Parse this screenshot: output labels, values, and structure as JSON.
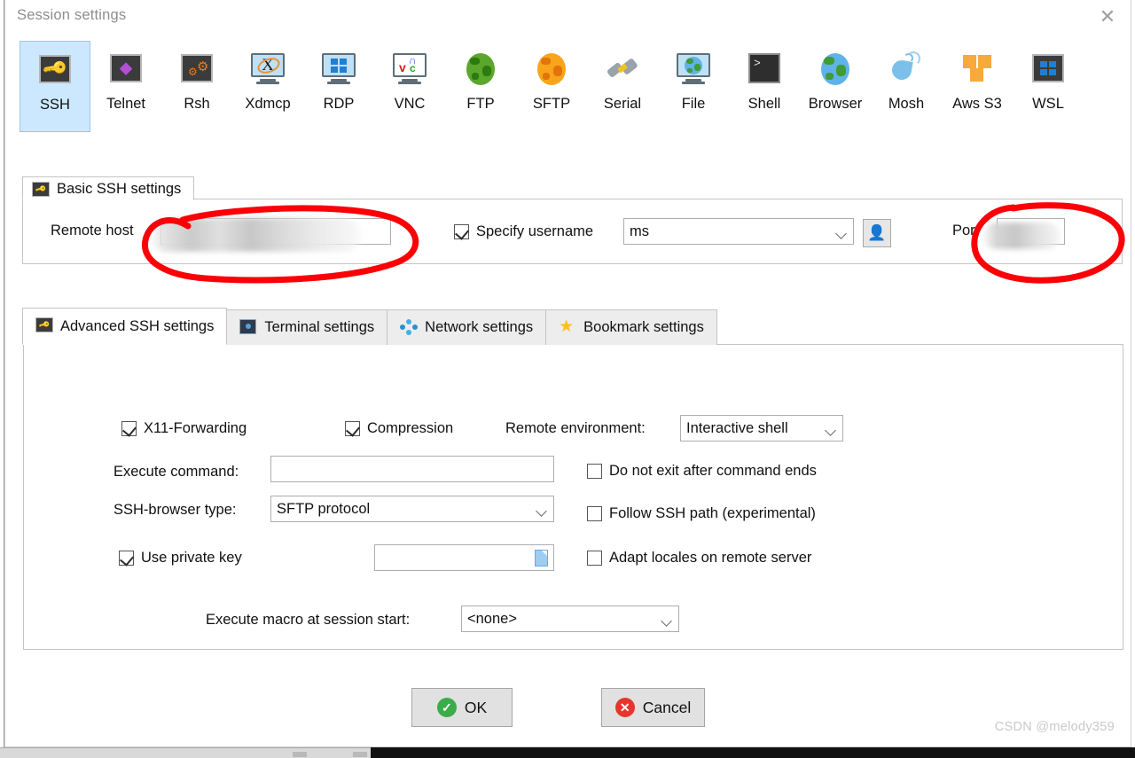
{
  "window": {
    "title": "Session settings",
    "close_label": "✕"
  },
  "protocols": [
    {
      "label": "SSH",
      "icon": "ssh-key-icon",
      "selected": true
    },
    {
      "label": "Telnet",
      "icon": "telnet-crystal-icon",
      "selected": false
    },
    {
      "label": "Rsh",
      "icon": "rsh-gears-icon",
      "selected": false
    },
    {
      "label": "Xdmcp",
      "icon": "xdmcp-monitor-icon",
      "selected": false
    },
    {
      "label": "RDP",
      "icon": "rdp-windows-icon",
      "selected": false
    },
    {
      "label": "VNC",
      "icon": "vnc-monitor-icon",
      "selected": false
    },
    {
      "label": "FTP",
      "icon": "ftp-green-globe-icon",
      "selected": false
    },
    {
      "label": "SFTP",
      "icon": "sftp-orange-globe-icon",
      "selected": false
    },
    {
      "label": "Serial",
      "icon": "serial-plug-icon",
      "selected": false
    },
    {
      "label": "File",
      "icon": "file-monitor-icon",
      "selected": false
    },
    {
      "label": "Shell",
      "icon": "shell-terminal-icon",
      "selected": false
    },
    {
      "label": "Browser",
      "icon": "browser-globe-icon",
      "selected": false
    },
    {
      "label": "Mosh",
      "icon": "mosh-satellite-icon",
      "selected": false
    },
    {
      "label": "Aws S3",
      "icon": "aws-s3-boxes-icon",
      "selected": false
    },
    {
      "label": "WSL",
      "icon": "wsl-windows-icon",
      "selected": false
    }
  ],
  "basic": {
    "group_title": "Basic SSH settings",
    "remote_host_label": "Remote host",
    "remote_host_value": "",
    "specify_username_label": "Specify username",
    "specify_username_checked": true,
    "username_value": "ms",
    "port_label": "Port",
    "port_value": ""
  },
  "tabs": [
    {
      "label": "Advanced SSH settings",
      "icon": "key-icon",
      "active": true
    },
    {
      "label": "Terminal settings",
      "icon": "terminal-icon",
      "active": false
    },
    {
      "label": "Network settings",
      "icon": "network-icon",
      "active": false
    },
    {
      "label": "Bookmark settings",
      "icon": "star-icon",
      "active": false
    }
  ],
  "advanced": {
    "x11_label": "X11-Forwarding",
    "x11_checked": true,
    "compression_label": "Compression",
    "compression_checked": true,
    "remote_env_label": "Remote environment:",
    "remote_env_value": "Interactive shell",
    "execute_command_label": "Execute command:",
    "execute_command_value": "",
    "ssh_browser_label": "SSH-browser type:",
    "ssh_browser_value": "SFTP protocol",
    "use_private_key_label": "Use private key",
    "use_private_key_checked": true,
    "private_key_value": "",
    "do_not_exit_label": "Do not exit after command ends",
    "do_not_exit_checked": false,
    "follow_ssh_path_label": "Follow SSH path (experimental)",
    "follow_ssh_path_checked": false,
    "adapt_locales_label": "Adapt locales on remote server",
    "adapt_locales_checked": false,
    "execute_macro_label": "Execute macro at session start:",
    "execute_macro_value": "<none>"
  },
  "footer": {
    "ok_label": "OK",
    "cancel_label": "Cancel"
  },
  "watermark": "CSDN @melody359",
  "colors": {
    "selection_blue": "#cce8ff",
    "annotation_red": "#fb0007",
    "ok_green": "#3aac49",
    "cancel_red": "#e8352c",
    "key_yellow": "#f5c518"
  }
}
